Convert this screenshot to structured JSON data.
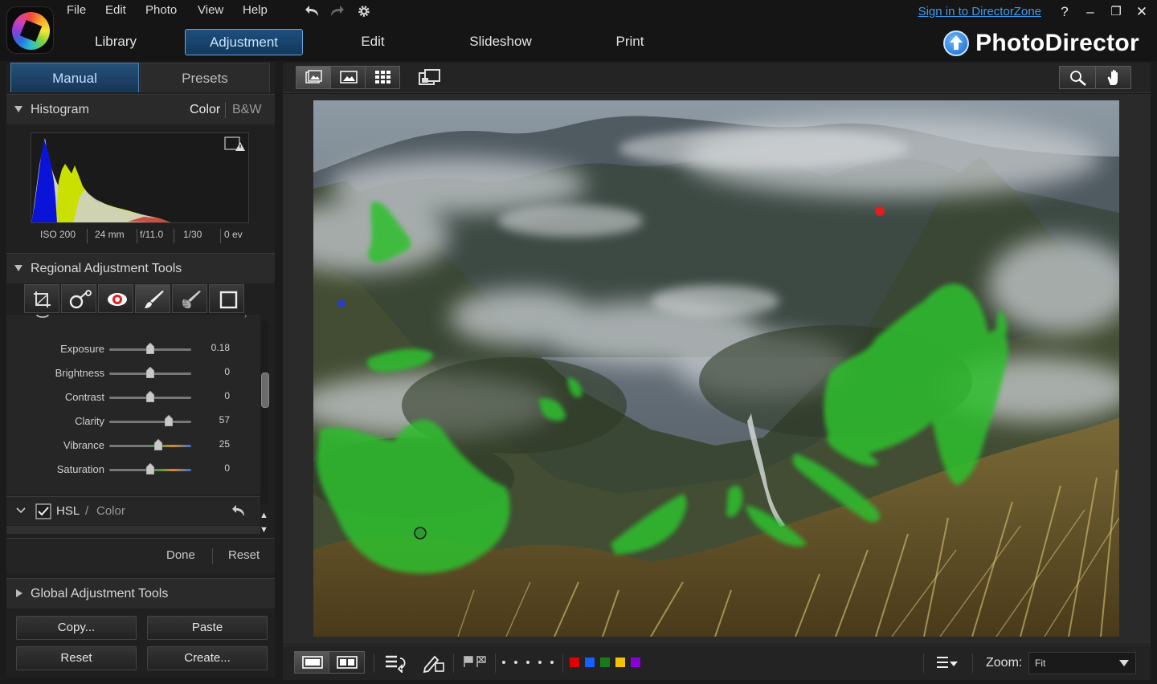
{
  "menu": [
    "File",
    "Edit",
    "Photo",
    "View",
    "Help"
  ],
  "signin": "Sign in to DirectorZone",
  "window_buttons": [
    "?",
    "–",
    "❐",
    "✕"
  ],
  "modules": [
    "Library",
    "Adjustment",
    "Edit",
    "Slideshow",
    "Print"
  ],
  "brand": "PhotoDirector",
  "panel_tabs": {
    "manual": "Manual",
    "presets": "Presets"
  },
  "histogram": {
    "title": "Histogram",
    "mode_color": "Color",
    "mode_bw": "B&W"
  },
  "exif": {
    "iso": "ISO 200",
    "focal": "24 mm",
    "aperture": "f/11.0",
    "shutter": "1/30",
    "ev": "0 ev"
  },
  "regional": {
    "title": "Regional Adjustment Tools"
  },
  "sliders": [
    {
      "label": "Exposure",
      "value": "0.18",
      "pos": 0.5
    },
    {
      "label": "Brightness",
      "value": "0",
      "pos": 0.5
    },
    {
      "label": "Contrast",
      "value": "0",
      "pos": 0.5
    },
    {
      "label": "Clarity",
      "value": "57",
      "pos": 0.73
    },
    {
      "label": "Vibrance",
      "value": "25",
      "pos": 0.6
    },
    {
      "label": "Saturation",
      "value": "0",
      "pos": 0.5
    }
  ],
  "hsl": {
    "label": "HSL",
    "sep": "/",
    "sub": "Color"
  },
  "done": "Done",
  "reset_link": "Reset",
  "global": {
    "title": "Global Adjustment Tools"
  },
  "buttons": {
    "copy": "Copy...",
    "paste": "Paste",
    "reset": "Reset",
    "create": "Create..."
  },
  "zoom": {
    "label": "Zoom:",
    "value": "Fit"
  },
  "colors": {
    "accent": "#2f6aa3",
    "link": "#3d9bf0",
    "labels": [
      "#e00000",
      "#1560ff",
      "#1a7a1a",
      "#f2c200",
      "#8a00d8"
    ]
  }
}
